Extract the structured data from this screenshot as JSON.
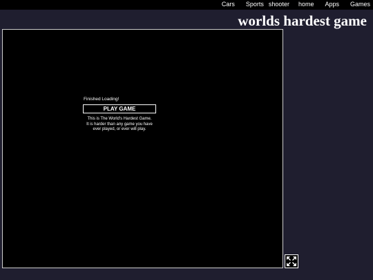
{
  "nav": {
    "items": [
      {
        "label": "Cars"
      },
      {
        "label": "Sports"
      },
      {
        "label": "shooter"
      },
      {
        "label": "home"
      },
      {
        "label": "Apps"
      },
      {
        "label": "Games"
      }
    ]
  },
  "site": {
    "title": "worlds hardest game"
  },
  "game": {
    "loading_status": "Finished Loading!",
    "play_button_label": "PLAY GAME",
    "description_lines": [
      "This is The World's Hardest Game.",
      "It is harder than any game you have",
      "ever played, or ever will play."
    ]
  },
  "controls": {
    "fullscreen_icon": "expand-arrows-icon"
  },
  "colors": {
    "page_background": "#1f1e2f",
    "topbar_background": "#000000",
    "game_background": "#000000",
    "text": "#ffffff"
  }
}
